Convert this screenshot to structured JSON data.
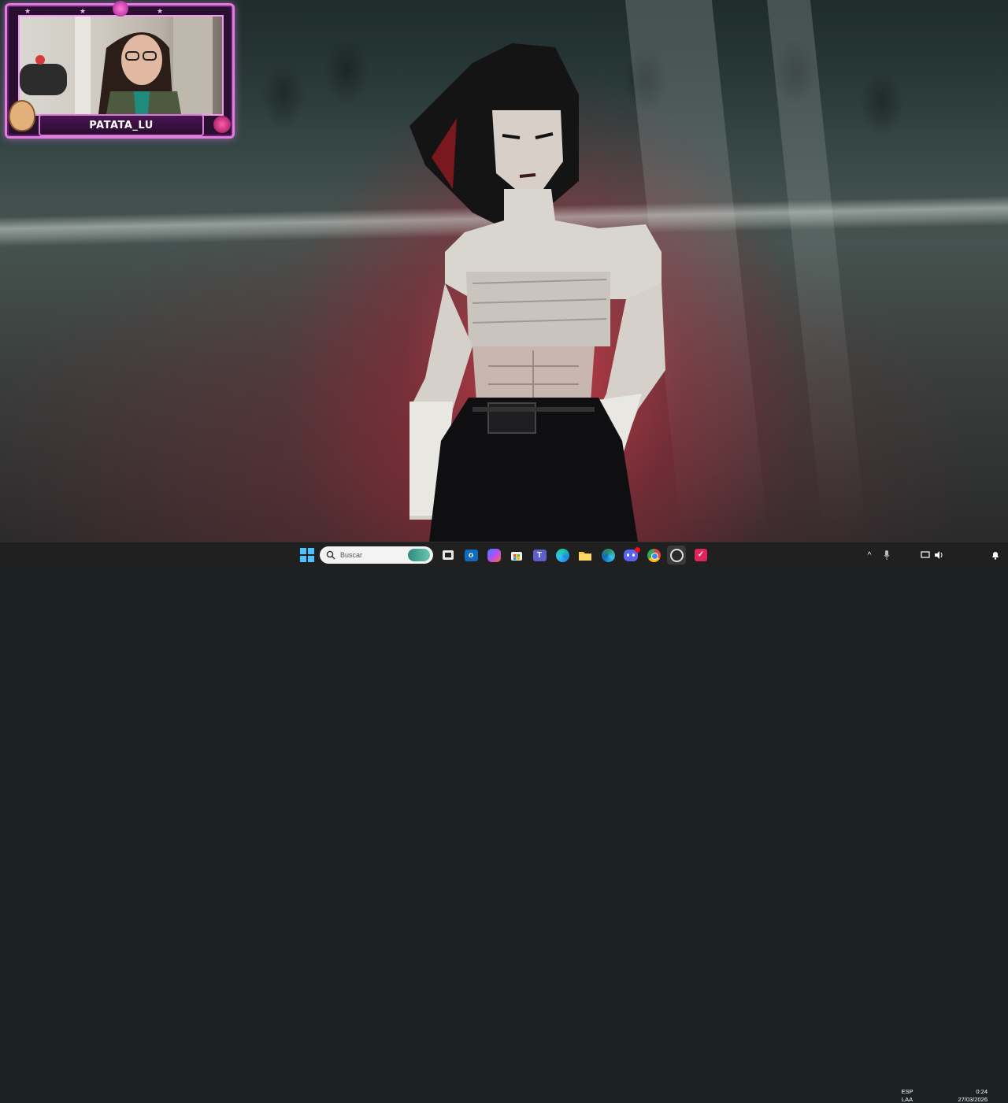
{
  "webcam_overlay": {
    "streamer_name": "PATATA_LU"
  },
  "taskbar": {
    "search_placeholder": "Buscar",
    "pinned_apps": [
      {
        "icon": "windows-start-icon"
      },
      {
        "icon": "search-icon"
      },
      {
        "icon": "task-view-icon"
      },
      {
        "icon": "outlook-icon"
      },
      {
        "icon": "copilot-icon"
      },
      {
        "icon": "microsoft-store-icon"
      },
      {
        "icon": "teams-icon"
      },
      {
        "icon": "edge-icon"
      },
      {
        "icon": "file-explorer-icon"
      },
      {
        "icon": "edge-dev-icon"
      },
      {
        "icon": "discord-icon"
      },
      {
        "icon": "chrome-icon"
      },
      {
        "icon": "obs-icon"
      },
      {
        "icon": "red-app-icon"
      }
    ],
    "tray": {
      "language_top": "ESP",
      "language_bottom": "LAA",
      "time": "0:24",
      "date": "27/03/2026"
    }
  },
  "colors": {
    "frame_accent": "#e07ee0",
    "taskbar_bg": "#202020"
  }
}
